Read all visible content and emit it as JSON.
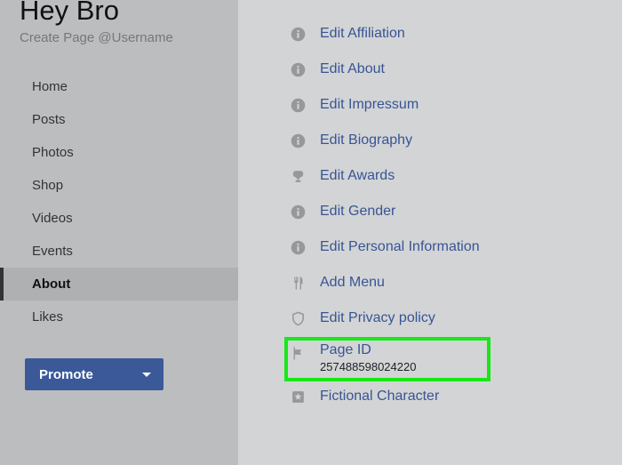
{
  "sidebar": {
    "title": "Hey Bro",
    "subtitle": "Create Page @Username",
    "nav": [
      {
        "label": "Home"
      },
      {
        "label": "Posts"
      },
      {
        "label": "Photos"
      },
      {
        "label": "Shop"
      },
      {
        "label": "Videos"
      },
      {
        "label": "Events"
      },
      {
        "label": "About",
        "active": true
      },
      {
        "label": "Likes"
      }
    ],
    "promote_label": "Promote"
  },
  "main": {
    "items": [
      {
        "icon": "info",
        "label": "Edit Affiliation"
      },
      {
        "icon": "info",
        "label": "Edit About"
      },
      {
        "icon": "info",
        "label": "Edit Impressum"
      },
      {
        "icon": "info",
        "label": "Edit Biography"
      },
      {
        "icon": "trophy",
        "label": "Edit Awards"
      },
      {
        "icon": "info",
        "label": "Edit Gender"
      },
      {
        "icon": "info",
        "label": "Edit Personal Information"
      },
      {
        "icon": "utensils",
        "label": "Add Menu"
      },
      {
        "icon": "shield",
        "label": "Edit Privacy policy"
      }
    ],
    "page_id": {
      "label": "Page ID",
      "value": "257488598024220"
    },
    "last_item": {
      "icon": "star-box",
      "label": "Fictional Character"
    }
  }
}
